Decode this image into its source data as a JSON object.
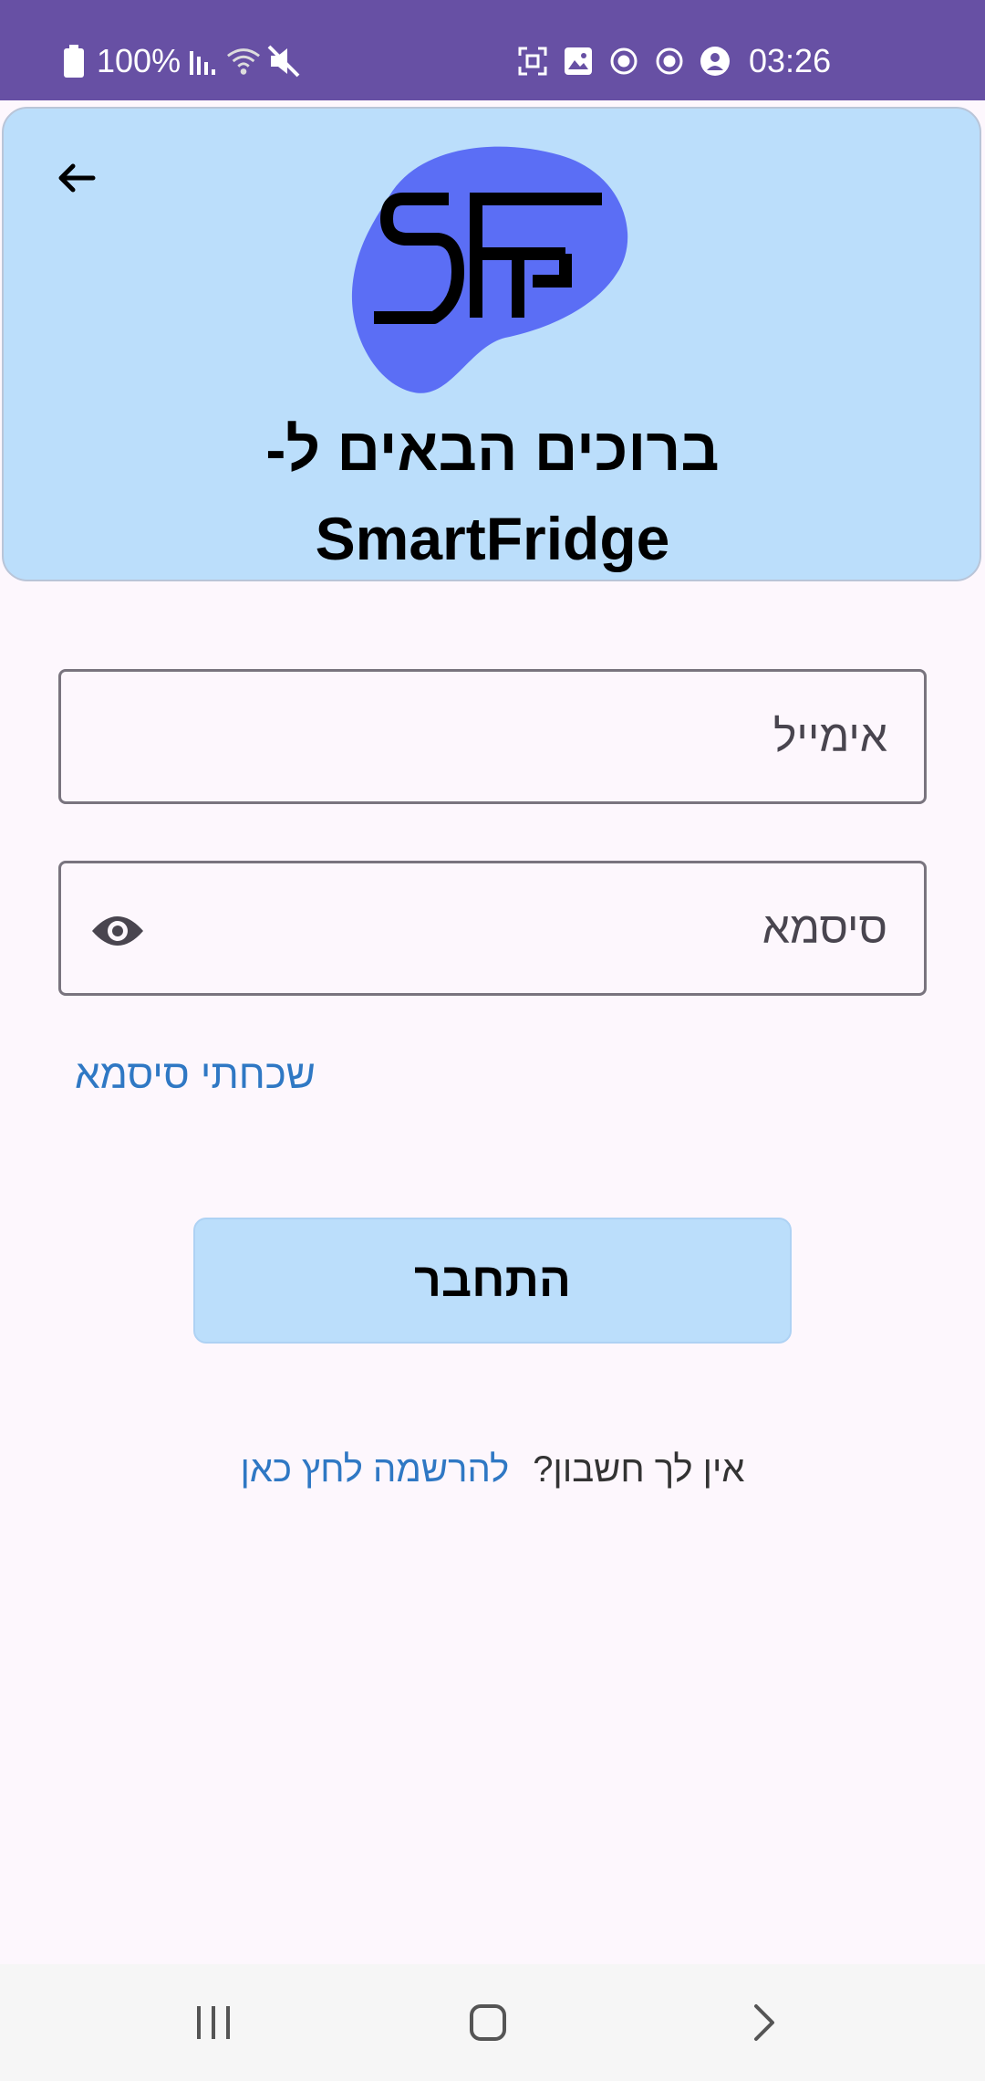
{
  "status_bar": {
    "battery": "100%",
    "time": "03:26",
    "icons": [
      "battery-icon",
      "signal-icon",
      "wifi-icon",
      "mute-icon",
      "screenshot-icon",
      "gallery-icon",
      "sync-icon",
      "sync-icon",
      "account-icon"
    ]
  },
  "header": {
    "back_icon": "arrow-left-icon",
    "logo_text": "SF",
    "welcome": "ברוכים הבאים ל-",
    "app_name": "SmartFridge",
    "background_color": "#bbdefb"
  },
  "form": {
    "email_placeholder": "אימייל",
    "email_value": "",
    "password_placeholder": "סיסמא",
    "password_value": "",
    "password_toggle_icon": "eye-icon",
    "forgot_password": "שכחתי סיסמא"
  },
  "login_button": "התחבר",
  "register": {
    "prompt": "אין לך חשבון?",
    "link": "להרשמה לחץ כאן"
  },
  "nav_bar": {
    "icons": [
      "recent-apps-icon",
      "home-icon",
      "back-icon"
    ]
  },
  "colors": {
    "status_bar": "#6750a4",
    "accent_link": "#2f78c4",
    "logo_blob": "#5b6ef5"
  }
}
